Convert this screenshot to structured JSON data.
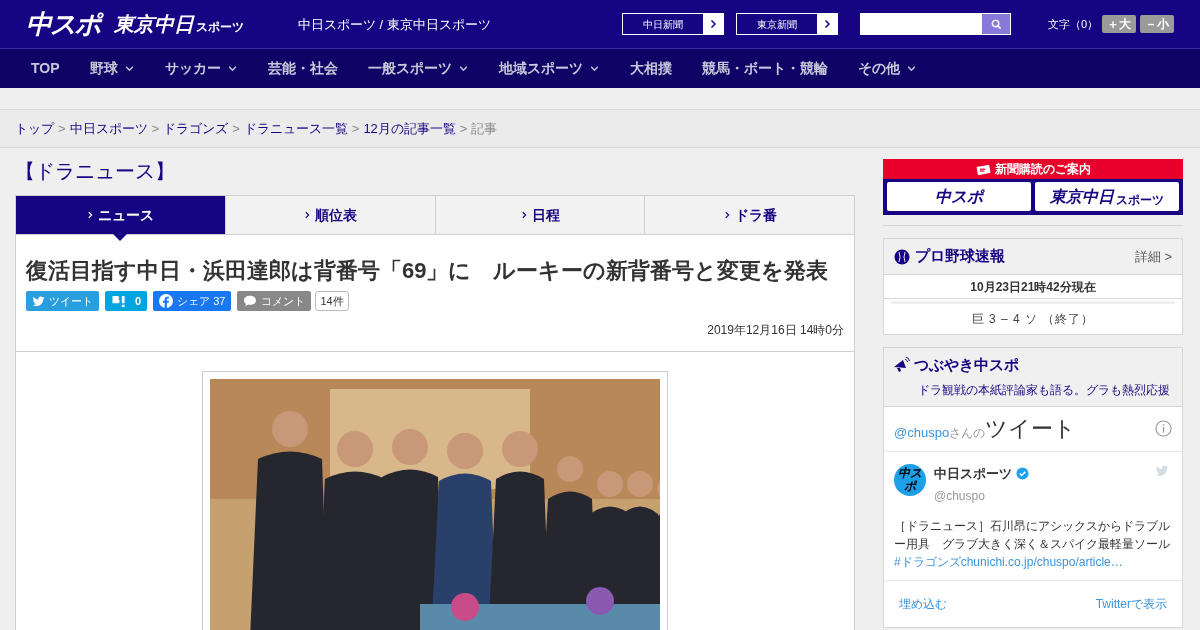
{
  "header": {
    "logo_main": "中スポ",
    "logo_sub_main": "東京中日",
    "logo_sub_small": "スポーツ",
    "site_name": "中日スポーツ / 東京中日スポーツ",
    "paper_links": [
      {
        "label": "中日新聞"
      },
      {
        "label": "東京新聞"
      }
    ],
    "font_size_label": "文字（0）",
    "font_buttons": [
      {
        "label": "＋大"
      },
      {
        "label": "－小"
      }
    ]
  },
  "nav": [
    {
      "label": "TOP",
      "dropdown": false
    },
    {
      "label": "野球",
      "dropdown": true
    },
    {
      "label": "サッカー",
      "dropdown": true
    },
    {
      "label": "芸能・社会",
      "dropdown": false
    },
    {
      "label": "一般スポーツ",
      "dropdown": true
    },
    {
      "label": "地域スポーツ",
      "dropdown": true
    },
    {
      "label": "大相撲",
      "dropdown": false
    },
    {
      "label": "競馬・ボート・競輪",
      "dropdown": false
    },
    {
      "label": "その他",
      "dropdown": true
    }
  ],
  "breadcrumb": [
    {
      "kind": "link",
      "label": "トップ"
    },
    {
      "kind": "separator",
      "label": ">"
    },
    {
      "kind": "link",
      "label": "中日スポーツ"
    },
    {
      "kind": "separator",
      "label": ">"
    },
    {
      "kind": "link",
      "label": "ドラゴンズ"
    },
    {
      "kind": "separator",
      "label": ">"
    },
    {
      "kind": "link",
      "label": "ドラニュース一覧"
    },
    {
      "kind": "separator",
      "label": ">"
    },
    {
      "kind": "link",
      "label": "12月の記事一覧"
    },
    {
      "kind": "separator",
      "label": ">"
    },
    {
      "kind": "current",
      "label": "記事"
    }
  ],
  "section_title": "【ドラニュース】",
  "tabs": [
    {
      "label": "ニュース",
      "selected": true
    },
    {
      "label": "順位表",
      "selected": false
    },
    {
      "label": "日程",
      "selected": false
    },
    {
      "label": "ドラ番",
      "selected": false
    }
  ],
  "article": {
    "title": "復活目指す中日・浜田達郎は背番号「69」に　ルーキーの新背番号と変更を発表",
    "share": [
      {
        "kind": "tweet",
        "label": "ツイート"
      },
      {
        "kind": "hatena",
        "label": "0"
      },
      {
        "kind": "facebook",
        "label": "シェア 37"
      },
      {
        "kind": "comment",
        "label": "コメント"
      }
    ],
    "comment_count": "14件",
    "date": "2019年12月16日 14時0分"
  },
  "sidebar": {
    "subscribe": {
      "title": "新聞購読のご案内",
      "logos": [
        {
          "main": "中スポ"
        },
        {
          "main": "東京中日",
          "small": "スポーツ"
        }
      ]
    },
    "baseball": {
      "title": "プロ野球速報",
      "detail": "詳細 >",
      "updated": "10月23日21時42分現在",
      "score": "巨 3 – 4 ソ （終了）"
    },
    "tweets": {
      "title": "つぶやき中スポ",
      "subtitle": "ドラ観戦の本紙評論家も語る。グラも熱烈応援",
      "handle_prefix": "@chuspo",
      "handle_suffix": "さんの",
      "heading": "ツイート",
      "account_name": "中日スポーツ",
      "account_handle": "@chuspo",
      "avatar_text": "中スポ",
      "text": "［ドラニュース］石川昂にアシックスからドラブルー用具　グラブ大きく深く＆スパイク最軽量ソール",
      "hashtag": "#ドラゴンズ",
      "url": "chunichi.co.jp/chuspo/article…",
      "embed": "埋め込む",
      "view": "Twitterで表示"
    }
  }
}
